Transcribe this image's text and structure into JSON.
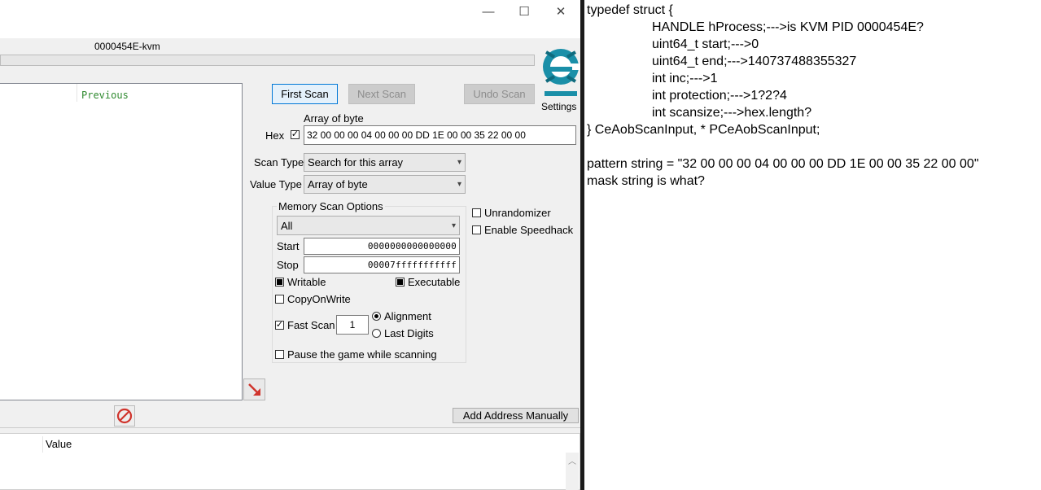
{
  "window": {
    "process_title": "0000454E-kvm",
    "controls": {
      "minimize": "—",
      "maximize": "☐",
      "close": "✕"
    }
  },
  "results": {
    "col_previous": "Previous"
  },
  "buttons": {
    "first_scan": "First Scan",
    "next_scan": "Next Scan",
    "undo_scan": "Undo Scan",
    "settings": "Settings",
    "add_address": "Add Address Manually"
  },
  "scan": {
    "value_type_label": "Array of byte",
    "hex_label": "Hex",
    "hex_checked": true,
    "value": "32 00 00 00 04 00 00 00 DD 1E 00 00 35 22 00 00",
    "scan_type_label": "Scan Type",
    "scan_type_value": "Search for this array",
    "value_type_field_label": "Value Type",
    "value_type_value": "Array of byte"
  },
  "memory": {
    "group_label": "Memory Scan Options",
    "region": "All",
    "start_label": "Start",
    "start_value": "0000000000000000",
    "stop_label": "Stop",
    "stop_value": "00007fffffffffff",
    "writable": "Writable",
    "executable": "Executable",
    "copy_on_write": "CopyOnWrite",
    "fast_scan": "Fast Scan",
    "fast_scan_value": "1",
    "alignment": "Alignment",
    "last_digits": "Last Digits",
    "pause_game": "Pause the game while scanning"
  },
  "options": {
    "unrandomizer": "Unrandomizer",
    "enable_speedhack": "Enable Speedhack"
  },
  "address_list": {
    "col_value": "Value"
  },
  "notes": {
    "lines": [
      "typedef struct {",
      "HANDLE hProcess;--->is KVM PID 0000454E?",
      "uint64_t start;--->0",
      "uint64_t end;--->140737488355327",
      "int inc;--->1",
      "int protection;--->1?2?4",
      "int scansize;--->hex.length?",
      "} CeAobScanInput, * PCeAobScanInput;",
      "pattern string = \"32 00 00 00 04 00 00 00 DD 1E 00 00 35 22 00 00\"",
      "mask string is what?"
    ]
  },
  "colors": {
    "previous_column": "#2f8a2f",
    "logo": "#1a8fa8",
    "arrow": "#d0342c",
    "divider": "#1b1b1b"
  },
  "icons": [
    "minimize-icon",
    "maximize-icon",
    "close-icon",
    "cheat-engine-logo-icon",
    "red-arrow-icon",
    "no-entry-icon",
    "chevron-down-icon",
    "scroll-up-icon"
  ]
}
